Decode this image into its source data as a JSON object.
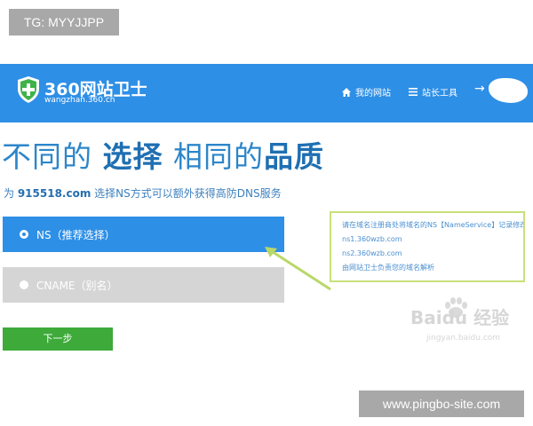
{
  "watermarks": {
    "top_left": "TG: MYYJJPP",
    "bottom_right": "www.pingbo-site.com"
  },
  "header": {
    "logo_title": "360网站卫士",
    "logo_subtitle": "wangzhan.360.cn",
    "nav_home": "我的网站",
    "nav_tools": "站长工具",
    "nav_arrow": "→",
    "background": "#2e8fe6"
  },
  "hero": {
    "part1": "不同的 ",
    "part2": "选择",
    "part3": " 相同的",
    "part4": "品质"
  },
  "subtitle": {
    "prefix": "为 ",
    "domain": "915518.com",
    "suffix": " 选择NS方式可以额外获得高防DNS服务"
  },
  "options": {
    "ns_label": "NS（推荐选择）",
    "cname_label": "CNAME（别名）",
    "selected": "ns"
  },
  "callout": {
    "line1": "请在域名注册商处将域名的NS【NameService】记录修改为",
    "line2": "ns1.360wzb.com",
    "line3": "ns2.360wzb.com",
    "line4": "由网站卫士负责您的域名解析"
  },
  "next_button": "下一步",
  "baidu_watermark": {
    "text": "Baidu 经验",
    "sub": "jingyan.baidu.com"
  },
  "colors": {
    "accent": "#2e8fe6",
    "button_green": "#3daa3a",
    "callout_border": "#c8e07a"
  }
}
